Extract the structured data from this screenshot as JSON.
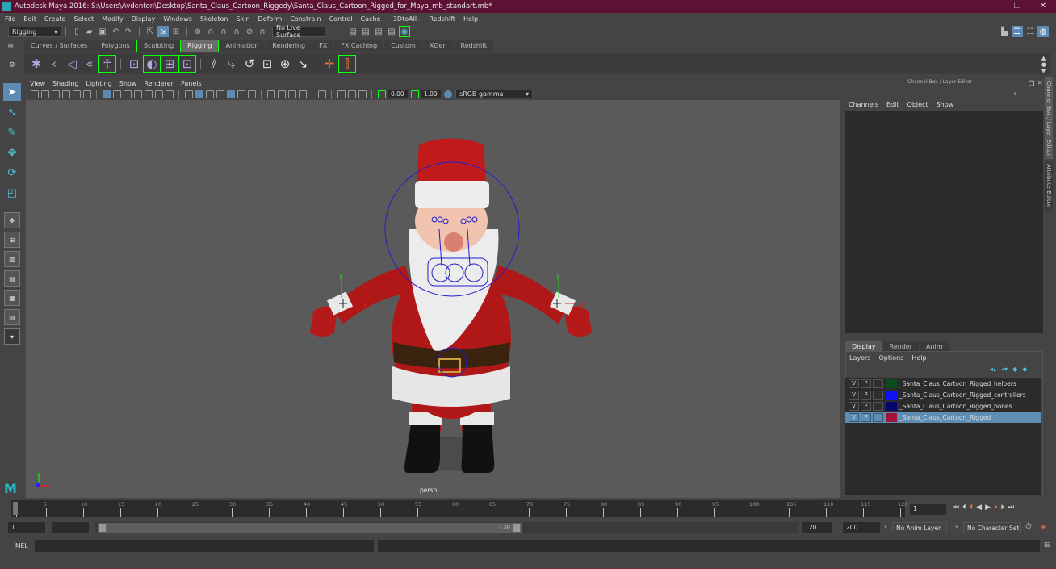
{
  "window": {
    "title": "Autodesk Maya 2016: S:\\Users\\Avdenton\\Desktop\\Santa_Claus_Cartoon_Riggedy\\Santa_Claus_Cartoon_Rigged_for_Maya_mb_standart.mb*",
    "controls": {
      "minimize": "–",
      "restore": "❐",
      "close": "✕"
    }
  },
  "menubar": [
    "File",
    "Edit",
    "Create",
    "Select",
    "Modify",
    "Display",
    "Windows",
    "Skeleton",
    "Skin",
    "Deform",
    "Constrain",
    "Control",
    "Cache",
    "- 3DtoAll -",
    "Redshift",
    "Help"
  ],
  "statusline": {
    "menuset": "Rigging",
    "live_surface": "No Live Surface"
  },
  "shelf": {
    "tabs": [
      "Curves / Surfaces",
      "Polygons",
      "Sculpting",
      "Rigging",
      "Animation",
      "Rendering",
      "FX",
      "FX Caching",
      "Custom",
      "XGen",
      "Redshift"
    ],
    "active_tab": "Rigging",
    "icons": [
      "joint-tool",
      "ik-handle",
      "ik-spline",
      "insert-joint",
      "humanik",
      "bind-skin",
      "paint-skin-weights",
      "lattice",
      "cluster",
      "parent-constraint",
      "point-constraint",
      "orient-constraint",
      "scale-constraint",
      "aim-constraint",
      "pole-vector",
      "locator",
      "bake-constraint"
    ]
  },
  "viewport": {
    "menu": [
      "View",
      "Shading",
      "Lighting",
      "Show",
      "Renderer",
      "Panels"
    ],
    "exposure": "0.00",
    "gamma": "1.00",
    "color_space": "sRGB gamma",
    "camera_label": "persp",
    "axis": {
      "x": "x",
      "y": "y"
    }
  },
  "channel_box": {
    "title": "Channel Box / Layer Editor",
    "menu": [
      "Channels",
      "Edit",
      "Object",
      "Show"
    ]
  },
  "side_tabs": [
    "Channel Box / Layer Editor",
    "Attribute Editor"
  ],
  "layer_editor": {
    "tabs": [
      "Display",
      "Render",
      "Anim"
    ],
    "active_tab": "Display",
    "menu": [
      "Layers",
      "Options",
      "Help"
    ],
    "layers": [
      {
        "v": "V",
        "p": "P",
        "color": "#0b4a1c",
        "name": "_Santa_Claus_Cartoon_Rigged_helpers",
        "selected": false
      },
      {
        "v": "V",
        "p": "P",
        "color": "#1010f0",
        "name": "_Santa_Claus_Cartoon_Rigged_controllers",
        "selected": false
      },
      {
        "v": "V",
        "p": "P",
        "color": "#05056e",
        "name": "_Santa_Claus_Cartoon_Rigged_bones",
        "selected": false
      },
      {
        "v": "V",
        "p": "P",
        "color": "#a0123a",
        "name": "_Santa_Claus_Cartoon_Rigged",
        "selected": true
      }
    ]
  },
  "timeline": {
    "ticks": [
      "1",
      "5",
      "10",
      "15",
      "20",
      "25",
      "30",
      "35",
      "40",
      "45",
      "50",
      "55",
      "60",
      "65",
      "70",
      "75",
      "80",
      "85",
      "90",
      "95",
      "100",
      "105",
      "110",
      "115",
      "120"
    ],
    "current_frame": "1"
  },
  "range": {
    "start": "1",
    "playback_start": "1",
    "slider_start": "1",
    "slider_end": "120",
    "playback_end": "120",
    "end": "200",
    "anim_layer": "No Anim Layer",
    "character_set": "No Character Set"
  },
  "command_line": {
    "label": "MEL"
  },
  "colors": {
    "accent": "#5c8ab3",
    "titlebar": "#5b1233",
    "viewport_bg": "#5a5a5a"
  }
}
